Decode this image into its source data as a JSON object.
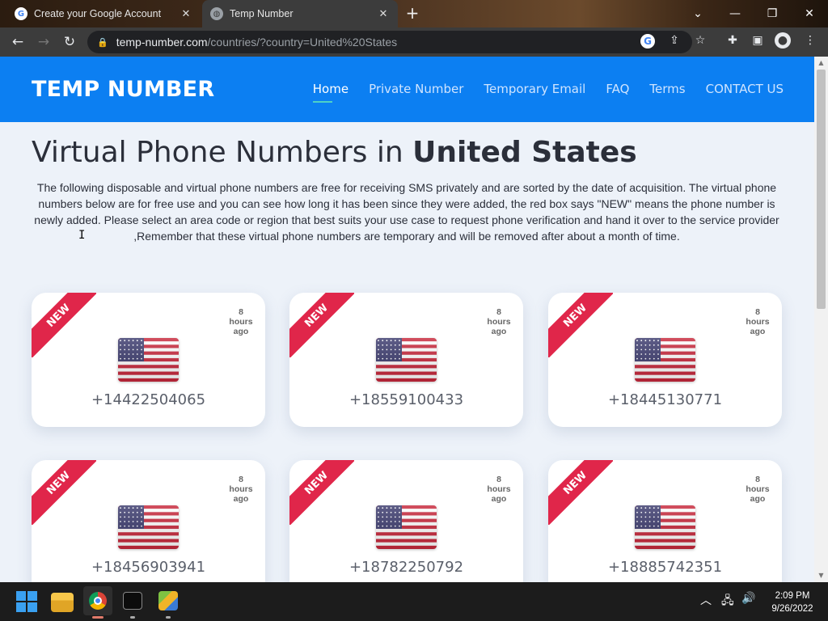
{
  "browser": {
    "tabs": [
      {
        "title": "Create your Google Account",
        "favicon": "google-icon",
        "active": false
      },
      {
        "title": "Temp Number",
        "favicon": "globe-icon",
        "active": true
      }
    ],
    "url_host": "temp-number.com",
    "url_path": "/countries/?country=United%20States"
  },
  "site": {
    "logo": "TEMP NUMBER",
    "nav": [
      {
        "label": "Home",
        "current": true
      },
      {
        "label": "Private Number",
        "current": false
      },
      {
        "label": "Temporary Email",
        "current": false
      },
      {
        "label": "FAQ",
        "current": false
      },
      {
        "label": "Terms",
        "current": false
      },
      {
        "label": "CONTACT US",
        "current": false
      }
    ],
    "title_prefix": "Virtual Phone Numbers in ",
    "title_country": "United States",
    "intro": "The following disposable and virtual phone numbers are free for receiving SMS privately and are sorted by the date of acquisition. The virtual phone numbers below are for free use and you can see how long it has been since they were added, the red box says \"NEW\" means the phone number is newly added. Please select an area code or region that best suits your use case to request phone verification and hand it over to the service provider ,Remember that these virtual phone numbers are temporary and will be removed after about a month of time."
  },
  "cards": [
    {
      "badge": "NEW",
      "age_num": "8",
      "age_unit": "hours",
      "age_suffix": "ago",
      "number": "+14422504065"
    },
    {
      "badge": "NEW",
      "age_num": "8",
      "age_unit": "hours",
      "age_suffix": "ago",
      "number": "+18559100433"
    },
    {
      "badge": "NEW",
      "age_num": "8",
      "age_unit": "hours",
      "age_suffix": "ago",
      "number": "+18445130771"
    },
    {
      "badge": "NEW",
      "age_num": "8",
      "age_unit": "hours",
      "age_suffix": "ago",
      "number": "+18456903941"
    },
    {
      "badge": "NEW",
      "age_num": "8",
      "age_unit": "hours",
      "age_suffix": "ago",
      "number": "+18782250792"
    },
    {
      "badge": "NEW",
      "age_num": "8",
      "age_unit": "hours",
      "age_suffix": "ago",
      "number": "+18885742351"
    }
  ],
  "taskbar": {
    "time": "2:09 PM",
    "date": "9/26/2022"
  },
  "colors": {
    "header_blue": "#0c7ff2",
    "ribbon_red": "#e0264a",
    "nav_underline": "#4fd1c5"
  }
}
